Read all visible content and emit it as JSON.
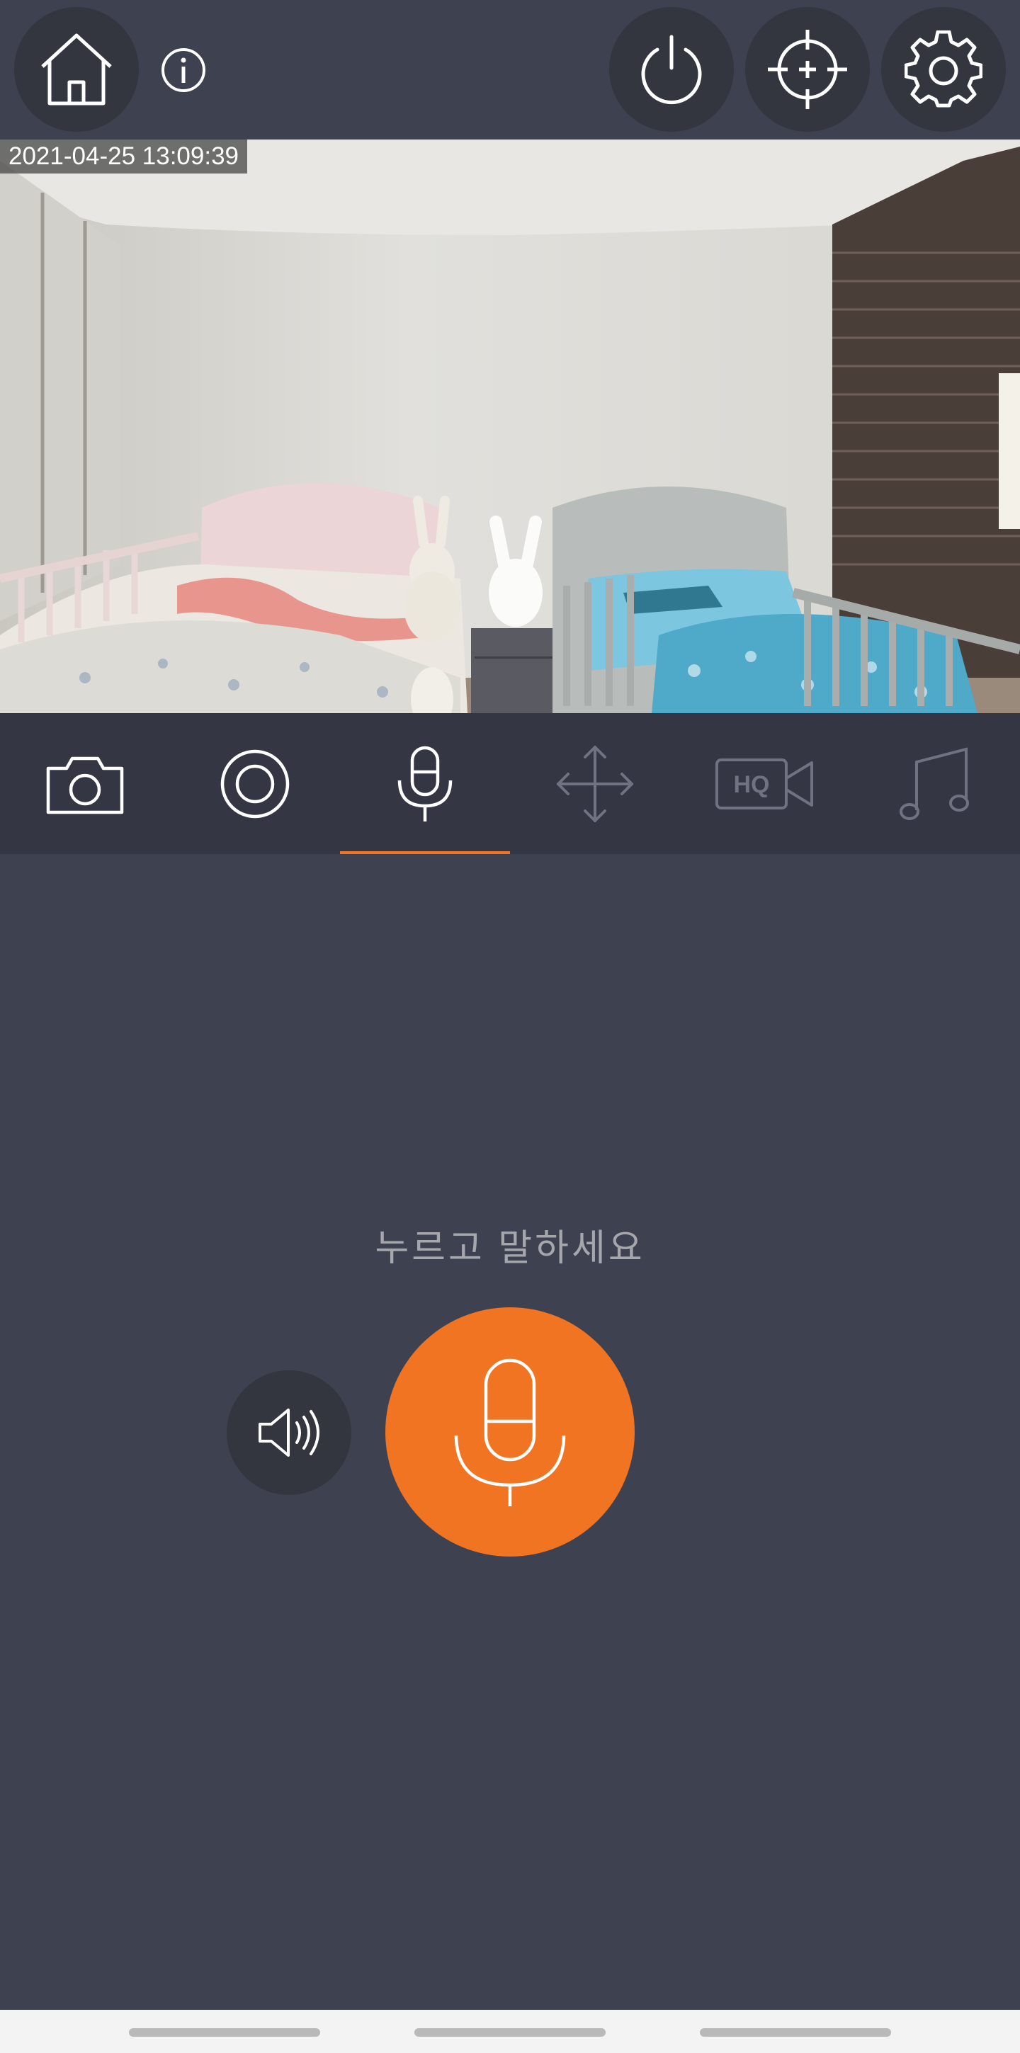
{
  "header": {
    "home_icon": "home-icon",
    "info_icon": "info-icon",
    "power_icon": "power-icon",
    "target_icon": "crosshair-icon",
    "settings_icon": "gear-icon"
  },
  "video": {
    "timestamp": "2021-04-25 13:09:39"
  },
  "toolbar": {
    "tools": [
      {
        "icon": "camera-icon",
        "active": false,
        "enabled": true
      },
      {
        "icon": "record-icon",
        "active": false,
        "enabled": true
      },
      {
        "icon": "microphone-icon",
        "active": true,
        "enabled": true
      },
      {
        "icon": "move-arrows-icon",
        "active": false,
        "enabled": false
      },
      {
        "icon": "hq-video-icon",
        "active": false,
        "enabled": false
      },
      {
        "icon": "music-icon",
        "active": false,
        "enabled": false
      }
    ],
    "hq_label": "HQ",
    "accent_color": "#f07422"
  },
  "talk": {
    "prompt": "누르고 말하세요",
    "speaker_icon": "speaker-icon",
    "mic_icon": "microphone-icon",
    "button_color": "#f07422"
  },
  "colors": {
    "background": "#3e4150",
    "toolbar": "#343644",
    "button_circle": "#33353f"
  }
}
